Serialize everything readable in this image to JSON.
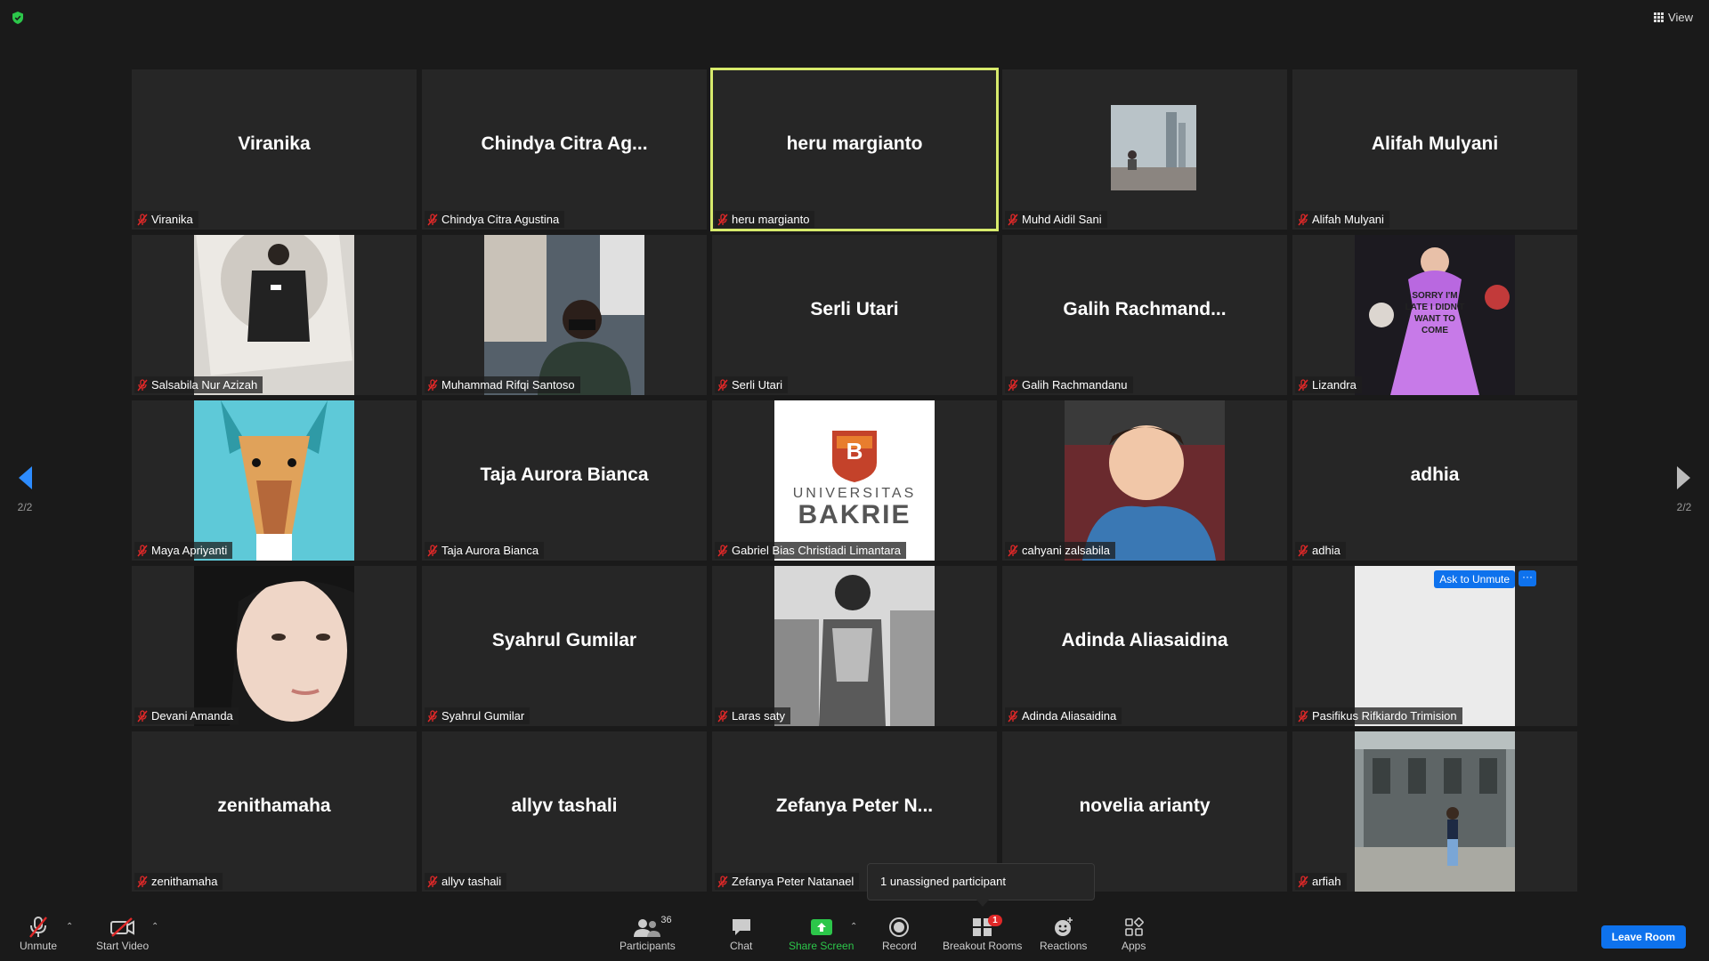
{
  "header": {
    "view_label": "View"
  },
  "pager": {
    "page_left": "2/2",
    "page_right": "2/2"
  },
  "tiles": [
    {
      "name": "Viranika",
      "display": "Viranika"
    },
    {
      "name": "Chindya Citra Agustina",
      "display": "Chindya  Citra  Ag..."
    },
    {
      "name": "heru margianto",
      "display": "heru margianto"
    },
    {
      "name": "Muhd Aidil Sani"
    },
    {
      "name": "Alifah Mulyani",
      "display": "Alifah Mulyani"
    },
    {
      "name": "Salsabila Nur Azizah"
    },
    {
      "name": "Muhammad Rifqi Santoso"
    },
    {
      "name": "Serli Utari",
      "display": "Serli Utari"
    },
    {
      "name": "Galih Rachmandanu",
      "display": "Galih  Rachmand..."
    },
    {
      "name": "Lizandra",
      "poster_text": "SORRY I'M LATE I DIDN'T WANT TO COME"
    },
    {
      "name": "Maya Apriyanti"
    },
    {
      "name": "Taja Aurora Bianca",
      "display": "Taja Aurora Bianca"
    },
    {
      "name": "Gabriel Bias Christiadi Limantara",
      "logo_line1": "UNIVERSITAS",
      "logo_line2": "BAKRIE",
      "logo_letter": "B"
    },
    {
      "name": "cahyani zalsabila"
    },
    {
      "name": "adhia",
      "display": "adhia"
    },
    {
      "name": "Devani Amanda"
    },
    {
      "name": "Syahrul Gumilar",
      "display": "Syahrul Gumilar"
    },
    {
      "name": "Laras saty"
    },
    {
      "name": "Adinda Aliasaidina",
      "display": "Adinda Aliasaidina"
    },
    {
      "name": "Pasifikus Rifkiardo Trimision"
    },
    {
      "name": "zenithamaha",
      "display": "zenithamaha"
    },
    {
      "name": "allyv tashali",
      "display": "allyv tashali"
    },
    {
      "name": "Zefanya Peter Natanael",
      "display": "Zefanya  Peter  N..."
    },
    {
      "name": "",
      "display": "novelia arianty"
    },
    {
      "name": "arfiah"
    }
  ],
  "overlay": {
    "ask_to_unmute": "Ask to Unmute",
    "more": "···"
  },
  "toast": {
    "text": "1 unassigned participant"
  },
  "toolbar": {
    "unmute": "Unmute",
    "start_video": "Start Video",
    "participants": "Participants",
    "participants_count": "36",
    "chat": "Chat",
    "share_screen": "Share Screen",
    "record": "Record",
    "breakout_rooms": "Breakout Rooms",
    "breakout_badge": "1",
    "reactions": "Reactions",
    "apps": "Apps",
    "leave_room": "Leave Room"
  },
  "colors": {
    "accent": "#0e72ed",
    "active_speaker": "#d7ea6c",
    "share_green": "#2cc64a",
    "mute_red": "#e02828",
    "tile_bg": "#262626"
  }
}
